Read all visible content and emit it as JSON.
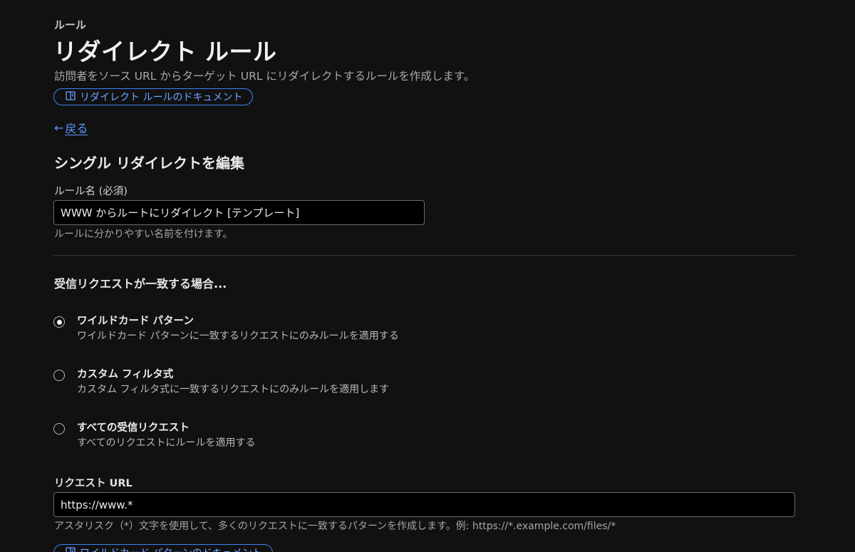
{
  "header": {
    "eyebrow": "ルール",
    "title": "リダイレクト ルール",
    "subtitle": "訪問者をソース URL からターゲット URL にリダイレクトするルールを作成します。",
    "doc_link": "リダイレクト ルールのドキュメント"
  },
  "nav": {
    "back_arrow": "←",
    "back_label": "戻る"
  },
  "section": {
    "title": "シングル リダイレクトを編集"
  },
  "rule_name": {
    "label": "ルール名 (必須)",
    "value": "WWW からルートにリダイレクト [テンプレート]",
    "help": "ルールに分かりやすい名前を付けます。"
  },
  "match": {
    "title": "受信リクエストが一致する場合...",
    "options": [
      {
        "label": "ワイルドカード パターン",
        "description": "ワイルドカード パターンに一致するリクエストにのみルールを適用する",
        "selected": true
      },
      {
        "label": "カスタム フィルタ式",
        "description": "カスタム フィルタ式に一致するリクエストにのみルールを適用します",
        "selected": false
      },
      {
        "label": "すべての受信リクエスト",
        "description": "すべてのリクエストにルールを適用する",
        "selected": false
      }
    ]
  },
  "request_url": {
    "label": "リクエスト URL",
    "value": "https://www.*",
    "help": "アスタリスク（*）文字を使用して、多くのリクエストに一致するパターンを作成します。例: https://*.example.com/files/*",
    "doc_link": "ワイルドカード パターンのドキュメント"
  },
  "colors": {
    "background": "#111112",
    "accent": "#3f82f6",
    "link": "#5d9bff"
  }
}
